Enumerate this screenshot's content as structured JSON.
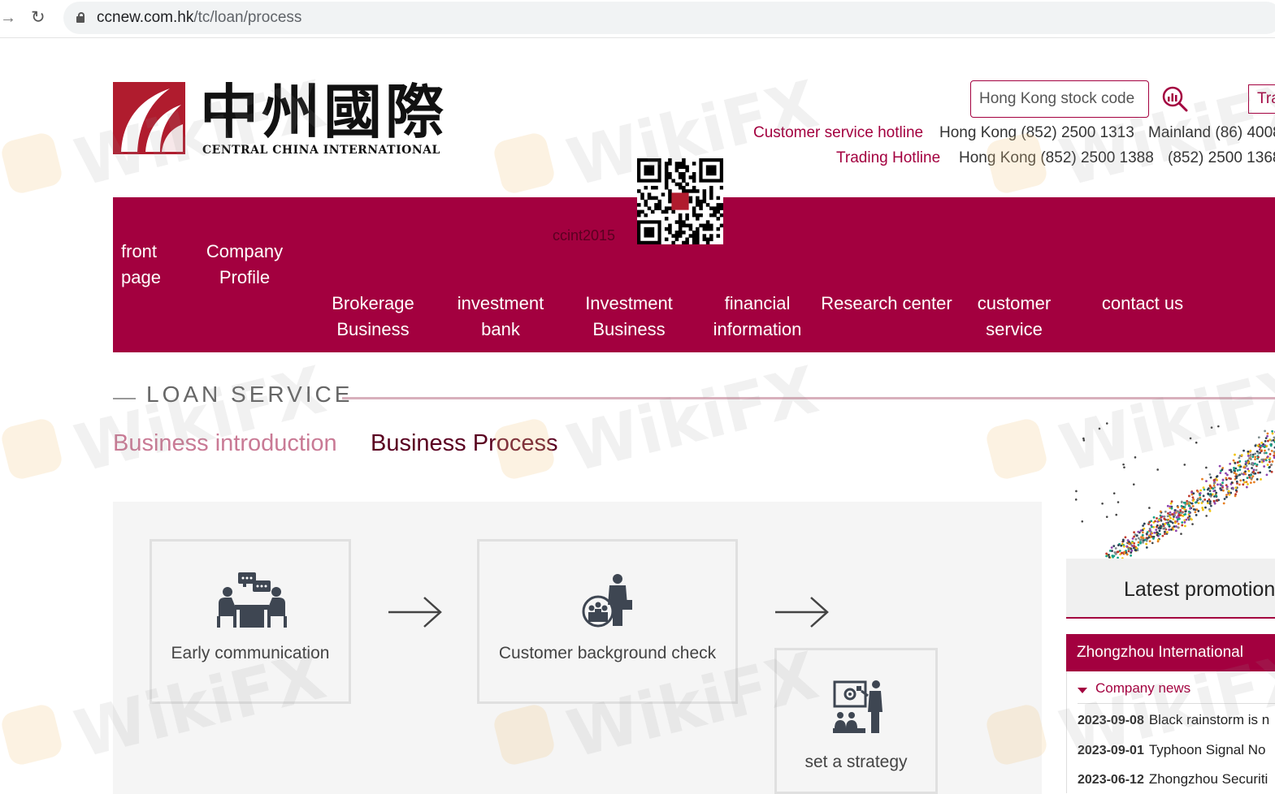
{
  "browser": {
    "url_host": "ccnew.com.hk",
    "url_path": "/tc/loan/process"
  },
  "header": {
    "logo_cn": "中州國際",
    "logo_en": "CENTRAL CHINA INTERNATIONAL",
    "search_placeholder": "Hong Kong stock code",
    "trade_label": "Tra",
    "customer_hotline_label": "Customer service hotline",
    "customer_hotline_hk": "Hong Kong (852) 2500 1313",
    "customer_hotline_mainland": "Mainland (86) 4008",
    "trading_hotline_label": "Trading Hotline",
    "trading_hotline_hk": "Hong Kong (852) 2500 1388",
    "trading_hotline_2": "(852) 2500 1368",
    "qr_label": "ccint2015"
  },
  "nav": {
    "front_page": [
      "front",
      "page"
    ],
    "company_profile": [
      "Company",
      "Profile"
    ],
    "brokerage": [
      "Brokerage",
      "Business"
    ],
    "investment_bank": [
      "investment",
      "bank"
    ],
    "investment_business": [
      "Investment",
      "Business"
    ],
    "financial_information": [
      "financial",
      "information"
    ],
    "research_center": "Research center",
    "customer_service": [
      "customer",
      "service"
    ],
    "contact_us": "contact us"
  },
  "section": {
    "title": "LOAN SERVICE",
    "tab_intro": "Business introduction",
    "tab_process": "Business Process"
  },
  "steps": [
    {
      "label": "Early communication",
      "icon": "meeting-icon"
    },
    {
      "label": "Customer background check",
      "icon": "background-check-icon"
    },
    {
      "label": "set a strategy",
      "icon": "strategy-icon"
    }
  ],
  "sidebar": {
    "promo_title": "Latest promotion",
    "org_label": "Zhongzhou International",
    "company_news_label": "Company news",
    "news": [
      {
        "date": "2023-09-08",
        "title": "Black rainstorm is n"
      },
      {
        "date": "2023-09-01",
        "title": "Typhoon Signal No"
      },
      {
        "date": "2023-06-12",
        "title": "Zhongzhou Securiti"
      }
    ]
  },
  "watermark": "WikiFX",
  "colors": {
    "brand": "#a3003f",
    "logo_red": "#b01c2e",
    "panel_bg": "#f5f5f5"
  }
}
